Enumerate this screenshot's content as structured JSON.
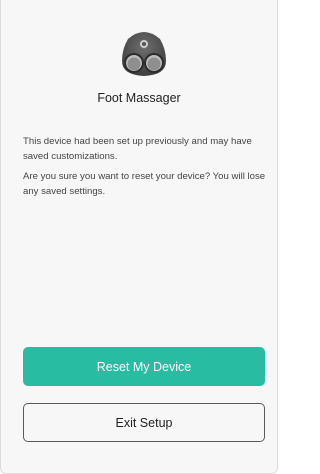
{
  "device": {
    "name": "Foot Massager",
    "image_icon": "foot-massager-icon"
  },
  "messages": {
    "previous_setup": "This device had been set up previously and may have saved customizations.",
    "confirm_reset": "Are you sure you want to reset your device? You will lose any saved settings."
  },
  "actions": {
    "reset_label": "Reset My Device",
    "exit_label": "Exit Setup"
  },
  "colors": {
    "accent": "#28bda2",
    "background": "#f7f7f7"
  }
}
